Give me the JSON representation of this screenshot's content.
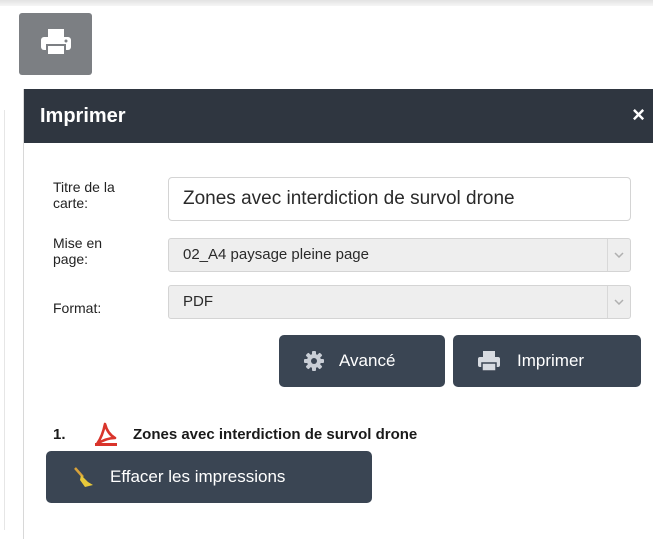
{
  "toolbar": {
    "print_tool_icon": "printer-icon"
  },
  "print_panel": {
    "title": "Imprimer",
    "close_symbol": "×",
    "fields": {
      "map_title_label": "Titre de la carte:",
      "map_title_value": "Zones avec interdiction de survol drone",
      "layout_label": "Mise en page:",
      "layout_value": "02_A4 paysage pleine page",
      "format_label": "Format:",
      "format_value": "PDF"
    },
    "buttons": {
      "advanced_label": "Avancé",
      "advanced_icon": "gear-icon",
      "print_label": "Imprimer",
      "print_icon": "printer-icon",
      "clear_label": "Effacer les impressions",
      "clear_icon": "broom-icon"
    },
    "results": [
      {
        "number": "1.",
        "icon": "pdf-icon",
        "label": "Zones avec interdiction de survol drone"
      }
    ]
  },
  "colors": {
    "header_bg": "#2f3640",
    "button_bg": "#3a4553",
    "tool_bg": "#7c7f83",
    "pdf_red": "#d9342b"
  }
}
